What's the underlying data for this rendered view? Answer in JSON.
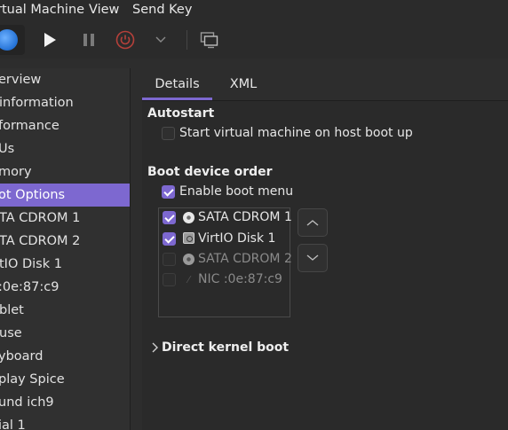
{
  "menu": {
    "items": [
      "rtual Machine",
      "View",
      "Send Key"
    ]
  },
  "toolbar": {
    "console_icon": "monitor-console-icon",
    "run_icon": "play-icon",
    "pause_icon": "pause-icon",
    "power_icon": "power-icon",
    "dropdown_icon": "chevron-down-icon",
    "snapshot_icon": "snapshot-icon",
    "accent_power": "#c0463f"
  },
  "sidebar": {
    "items": [
      {
        "label": "erview",
        "selected": false
      },
      {
        "label": "information",
        "selected": false
      },
      {
        "label": "formance",
        "selected": false
      },
      {
        "label": "Us",
        "selected": false
      },
      {
        "label": "mory",
        "selected": false
      },
      {
        "label": "ot Options",
        "selected": true
      },
      {
        "label": "TA CDROM 1",
        "selected": false
      },
      {
        "label": "TA CDROM 2",
        "selected": false
      },
      {
        "label": "tIO Disk 1",
        "selected": false
      },
      {
        "label": ":0e:87:c9",
        "selected": false
      },
      {
        "label": "blet",
        "selected": false
      },
      {
        "label": "use",
        "selected": false
      },
      {
        "label": "yboard",
        "selected": false
      },
      {
        "label": "play Spice",
        "selected": false
      },
      {
        "label": "und ich9",
        "selected": false
      },
      {
        "label": "ial 1",
        "selected": false
      }
    ]
  },
  "tabs": [
    {
      "label": "Details",
      "active": true
    },
    {
      "label": "XML",
      "active": false
    }
  ],
  "autostart": {
    "heading": "Autostart",
    "checkbox_label": "Start virtual machine on host boot up",
    "checked": false
  },
  "boot": {
    "heading": "Boot device order",
    "enable_menu_label": "Enable boot menu",
    "enable_menu_checked": true,
    "devices": [
      {
        "label": "SATA CDROM 1",
        "icon": "cdrom-icon",
        "checked": true,
        "enabled": true
      },
      {
        "label": "VirtIO Disk 1",
        "icon": "disk-icon",
        "checked": true,
        "enabled": true
      },
      {
        "label": "SATA CDROM 2",
        "icon": "cdrom-icon",
        "checked": false,
        "enabled": false
      },
      {
        "label": "NIC :0e:87:c9",
        "icon": "network-icon",
        "checked": false,
        "enabled": false
      }
    ],
    "move_up_icon": "chevron-up-icon",
    "move_down_icon": "chevron-down-icon"
  },
  "direct_kernel": {
    "label": "Direct kernel boot",
    "expander_icon": "chevron-right-icon"
  },
  "colors": {
    "accent": "#7d68d0",
    "background": "#2d2d2d"
  }
}
